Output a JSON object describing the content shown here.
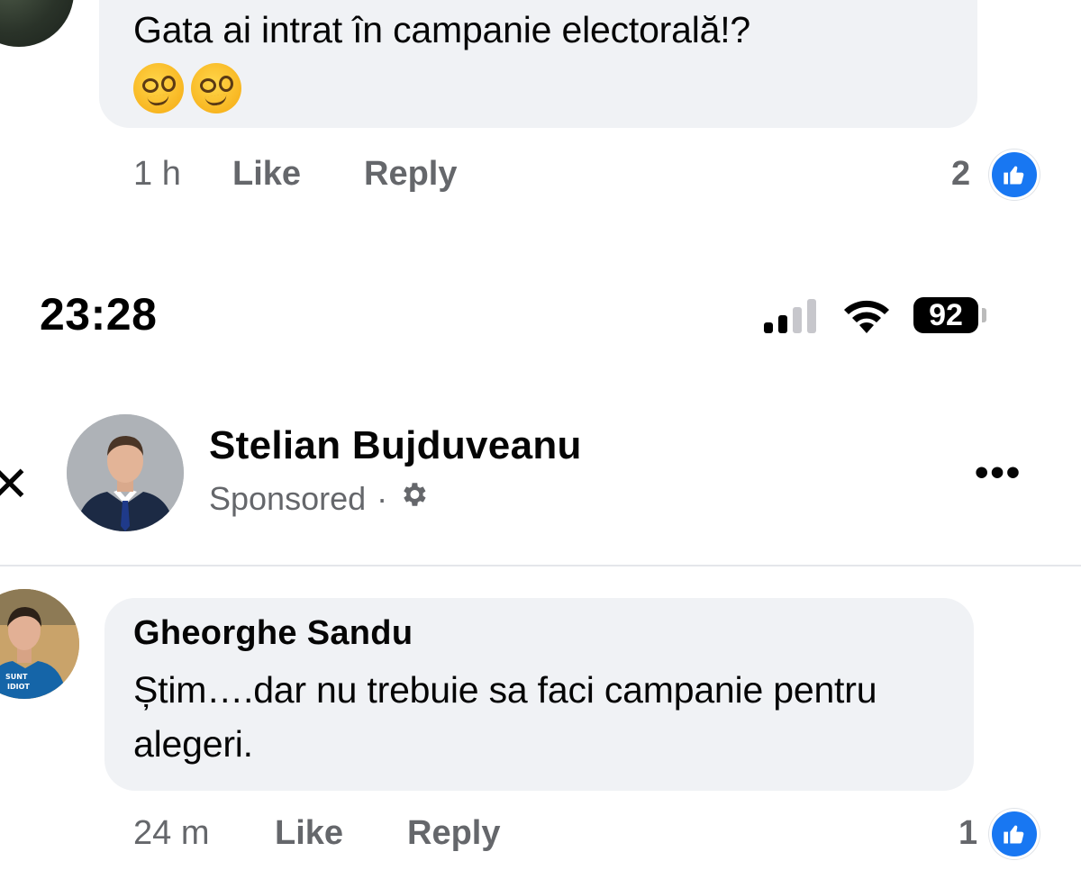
{
  "top_comment": {
    "text": "Gata ai intrat în campanie electorală!?",
    "emojis": [
      "woozy-face",
      "woozy-face"
    ],
    "time": "1 h",
    "like_label": "Like",
    "reply_label": "Reply",
    "reaction_count": "2"
  },
  "status_bar": {
    "time": "23:28",
    "battery": "92"
  },
  "post": {
    "author": "Stelian Bujduveanu",
    "sponsored_label": "Sponsored",
    "separator": "·",
    "more_label": "•••"
  },
  "second_comment": {
    "author": "Gheorghe Sandu",
    "text": "Știm….dar nu trebuie sa faci campanie pentru alegeri.",
    "avatar_shirt_text": "SUNT IDIOT",
    "time": "24 m",
    "like_label": "Like",
    "reply_label": "Reply",
    "reaction_count": "1"
  },
  "colors": {
    "bubble": "#f0f2f5",
    "meta_text": "#65676b",
    "like_blue": "#1877f2",
    "text": "#050505"
  }
}
